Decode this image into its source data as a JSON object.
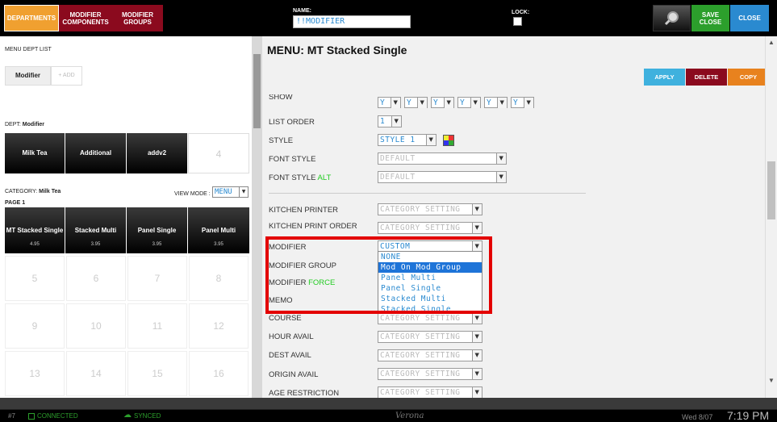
{
  "topbar": {
    "departments": "DEPARTMENTS",
    "modifier_components": "MODIFIER\nCOMPONENTS",
    "modifier_groups": "MODIFIER\nGROUPS",
    "name_label": "NAME:",
    "name_value": "!!MODIFIER",
    "lock_label": "LOCK:",
    "save_close": "SAVE\nCLOSE",
    "close": "CLOSE"
  },
  "left": {
    "menu_dept_list": "MENU DEPT LIST",
    "modifier_tab": "Modifier",
    "add_tab": "+ ADD",
    "dept_label": "DEPT:",
    "dept_value": "Modifier",
    "dept_buttons": [
      "Milk Tea",
      "Additional",
      "addv2",
      "4"
    ],
    "category_label": "CATEGORY:",
    "category_value": "Milk Tea",
    "view_mode_label": "VIEW MODE :",
    "view_mode_value": "MENU",
    "page_label": "PAGE 1",
    "items": [
      {
        "name": "MT Stacked Single",
        "price": "4.95"
      },
      {
        "name": "Stacked Multi",
        "price": "3.95"
      },
      {
        "name": "Panel Single",
        "price": "3.95"
      },
      {
        "name": "Panel Multi",
        "price": "3.95"
      }
    ],
    "empty_cells": [
      "5",
      "6",
      "7",
      "8",
      "9",
      "10",
      "11",
      "12",
      "13",
      "14",
      "15",
      "16"
    ]
  },
  "main": {
    "title": "MENU: MT Stacked Single",
    "apply": "APPLY",
    "delete": "DELETE",
    "copy": "COPY",
    "show_label": "SHOW",
    "show_value": "Y",
    "list_order_label": "LIST ORDER",
    "list_order_value": "1",
    "style_label": "STYLE",
    "style_value": "STYLE 1",
    "font_style_label": "FONT STYLE",
    "font_style_value": "DEFAULT",
    "font_style_alt_label": "FONT STYLE",
    "font_style_alt_suffix": "ALT",
    "font_style_alt_value": "DEFAULT",
    "kitchen_printer_label": "KITCHEN PRINTER",
    "kitchen_print_order_label": "KITCHEN PRINT ORDER",
    "category_setting": "CATEGORY SETTING",
    "modifier_label": "MODIFIER",
    "modifier_value": "CUSTOM",
    "modifier_group_label": "MODIFIER GROUP",
    "modifier_force_label": "MODIFIER",
    "modifier_force_suffix": "FORCE",
    "memo_label": "MEMO",
    "course_label": "COURSE",
    "hour_avail_label": "HOUR AVAIL",
    "dest_avail_label": "DEST AVAIL",
    "origin_avail_label": "ORIGIN AVAIL",
    "age_restriction_label": "AGE RESTRICTION",
    "dropdown_options": [
      "NONE",
      "Mod On Mod Group",
      "Panel Multi",
      "Panel Single",
      "Stacked Multi",
      "Stacked Single"
    ],
    "dropdown_selected": "Mod On Mod Group"
  },
  "statusbar": {
    "station": "#7",
    "connected": "CONNECTED",
    "synced": "SYNCED",
    "center": "Verona",
    "date": "Wed 8/07",
    "time": "7:19 PM"
  },
  "colors": {
    "departments": "#f0a030",
    "modifier_buttons": "#8b0a1e",
    "save_close": "#2c9f2c",
    "close": "#2a8ad0",
    "apply": "#3fb1de",
    "delete": "#8b0a1e",
    "copy": "#e8821e",
    "highlight": "#e30000",
    "force": "#22cc22"
  }
}
